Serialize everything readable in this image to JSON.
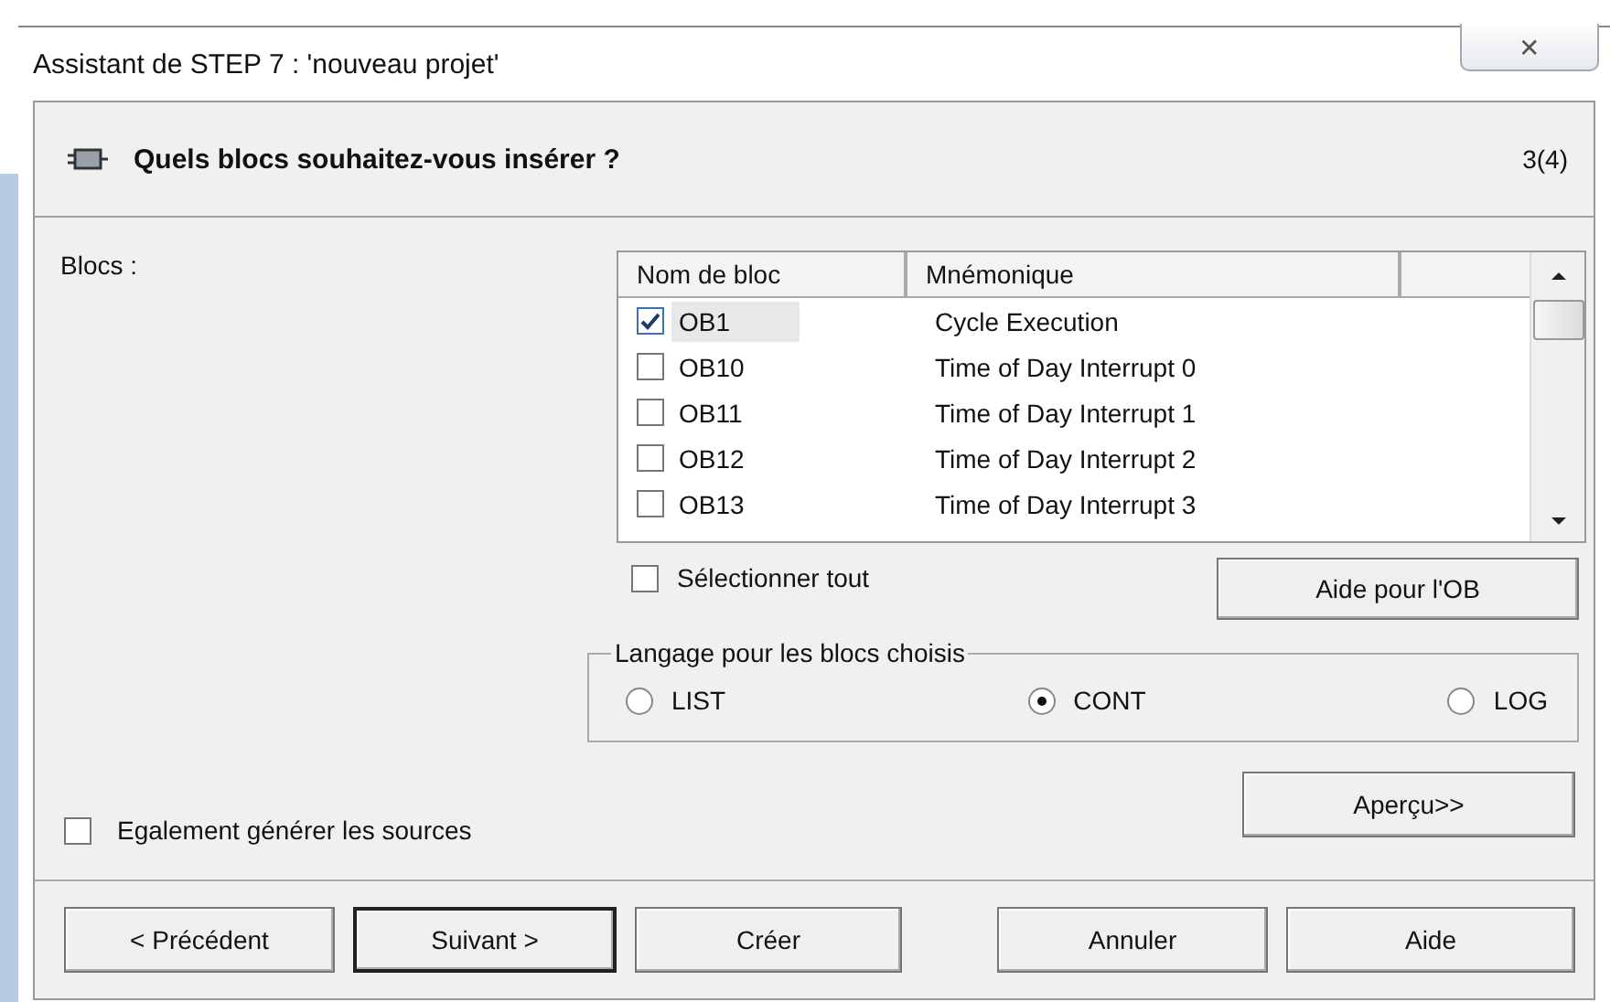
{
  "window": {
    "title": "Assistant de STEP 7 : 'nouveau projet'",
    "close": "✕"
  },
  "header": {
    "title": "Quels blocs souhaitez-vous insérer ?",
    "step": "3(4)"
  },
  "blocks_label": "Blocs :",
  "table": {
    "columns": [
      "Nom de bloc",
      "Mnémonique"
    ],
    "rows": [
      {
        "name": "OB1",
        "mnemonic": "Cycle Execution",
        "checked": true,
        "selected": true
      },
      {
        "name": "OB10",
        "mnemonic": "Time of Day Interrupt 0",
        "checked": false,
        "selected": false
      },
      {
        "name": "OB11",
        "mnemonic": "Time of Day Interrupt 1",
        "checked": false,
        "selected": false
      },
      {
        "name": "OB12",
        "mnemonic": "Time of Day Interrupt 2",
        "checked": false,
        "selected": false
      },
      {
        "name": "OB13",
        "mnemonic": "Time of Day Interrupt 3",
        "checked": false,
        "selected": false
      }
    ]
  },
  "select_all": {
    "label": "Sélectionner tout",
    "checked": false
  },
  "ob_help_button": "Aide pour l'OB",
  "language_group": {
    "title": "Langage pour les blocs choisis",
    "options": [
      {
        "label": "LIST",
        "selected": false
      },
      {
        "label": "CONT",
        "selected": true
      },
      {
        "label": "LOG",
        "selected": false
      }
    ]
  },
  "generate_sources": {
    "label": "Egalement générer les sources",
    "checked": false
  },
  "preview_button": "Aperçu>>",
  "buttons": [
    {
      "label": "< Précédent",
      "default": false
    },
    {
      "label": "Suivant >",
      "default": true
    },
    {
      "label": "Créer",
      "default": false
    },
    {
      "label": "Annuler",
      "default": false
    },
    {
      "label": "Aide",
      "default": false
    }
  ]
}
